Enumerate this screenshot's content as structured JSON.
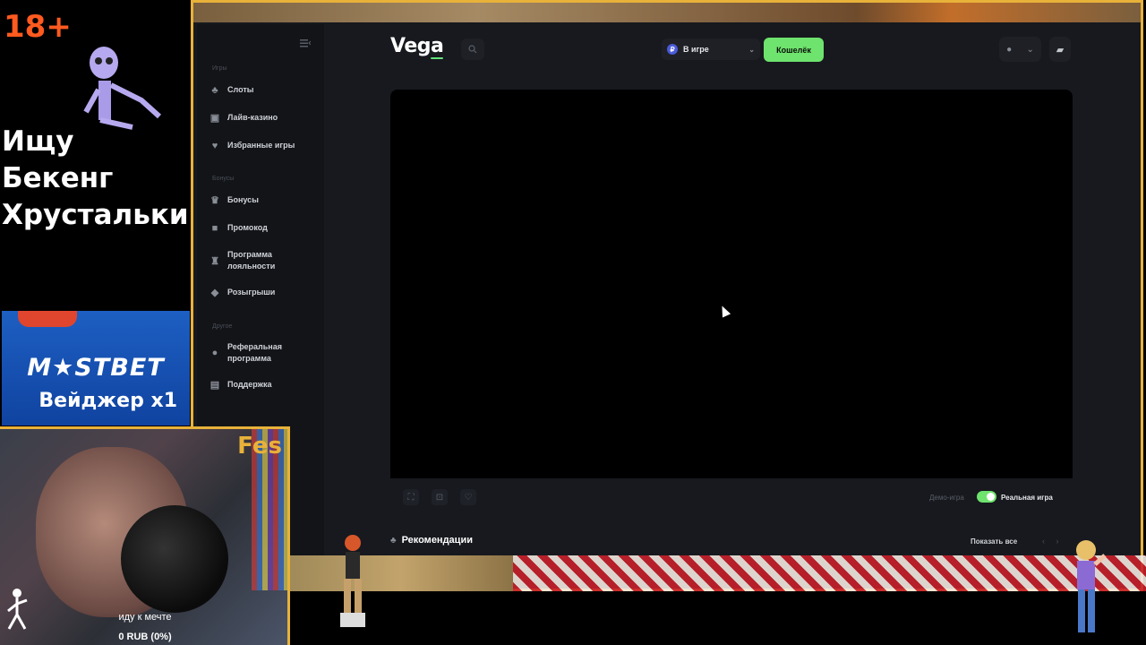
{
  "overlay": {
    "age_badge": "18+",
    "title_line1": "Ищу Бекенг",
    "title_line2": "Хрустальки",
    "sponsor_logo": "M★STBET",
    "sponsor_sub": "Вейджер х1"
  },
  "webcam": {
    "label": "Fes",
    "text_line": "иду к мечте",
    "progress_text": "0 RUB (0%)"
  },
  "app": {
    "logo_prefix": "Veg",
    "logo_suffix": "a",
    "balance_label": "В игре",
    "wallet_label": "Кошелёк",
    "sidebar": {
      "section_games": "Игры",
      "section_bonuses": "Бонусы",
      "section_other": "Другое",
      "items": [
        {
          "label": "Слоты",
          "icon": "cherry-icon"
        },
        {
          "label": "Лайв-казино",
          "icon": "chat-icon"
        },
        {
          "label": "Избранные игры",
          "icon": "heart-icon"
        },
        {
          "label": "Бонусы",
          "icon": "crown-icon"
        },
        {
          "label": "Промокод",
          "icon": "gift-icon"
        },
        {
          "label": "Программа лояльности",
          "icon": "trophy-icon"
        },
        {
          "label": "Розыгрыши",
          "icon": "ticket-icon"
        },
        {
          "label": "Реферальная программа",
          "icon": "users-icon"
        },
        {
          "label": "Поддержка",
          "icon": "support-icon"
        }
      ]
    },
    "game_bar": {
      "demo_label": "Демо-игра",
      "real_label": "Реальная игра",
      "real_mode_on": true
    },
    "recommendations_title": "Рекомендации",
    "show_all_label": "Показать все"
  },
  "colors": {
    "accent_green": "#6ee36d",
    "frame_gold": "#e8b23a",
    "age_orange": "#ff5a1f",
    "sponsor_blue": "#1d5fc2"
  }
}
